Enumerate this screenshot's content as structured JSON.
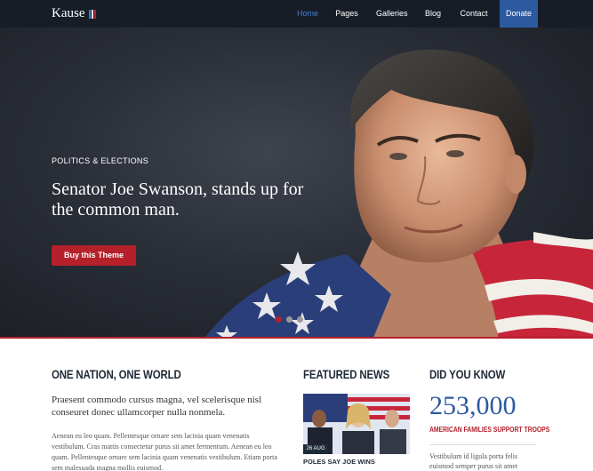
{
  "brand": {
    "name": "Kause",
    "bar_colors": [
      "#3d7fd1",
      "#ffffff",
      "#b5202a"
    ]
  },
  "nav": {
    "items": [
      {
        "label": "Home",
        "active": true
      },
      {
        "label": "Pages",
        "active": false
      },
      {
        "label": "Galleries",
        "active": false
      },
      {
        "label": "Blog",
        "active": false
      },
      {
        "label": "Contact",
        "active": false
      }
    ],
    "donate": "Donate"
  },
  "hero": {
    "kicker": "POLITICS & ELECTIONS",
    "title": "Senator Joe Swanson, stands up for the common man.",
    "button": "Buy this Theme",
    "slides_total": 3,
    "active_slide": 1
  },
  "section_one": {
    "heading": "ONE NATION, ONE WORLD",
    "intro": "Praesent commodo cursus magna, vel scelerisque nisl conseuret donec ullamcorper nulla nonmela.",
    "body": "Aenean eu leo quam. Pellentesque ornare sem lacinia quam venenatis vestibulum. Cras mattis consectetur purus sit amet fermentum. Aenean eu leo quam. Pellentesque ornare sem lacinia quam venenatis vestibulum. Etiam porta sem malesuada magna mollis euismod."
  },
  "featured_news": {
    "heading": "FEATURED NEWS",
    "date": "26 AUG",
    "title": "POLES SAY JOE WINS"
  },
  "did_you_know": {
    "heading": "DID YOU KNOW",
    "number": "253,000",
    "label": "AMERICAN FAMILIES SUPPORT TROOPS",
    "text": "Vestibulum id ligula porta felis euismod semper purus sit amet"
  },
  "colors": {
    "nav_bg": "#171d27",
    "accent_red": "#b5202a",
    "accent_blue": "#2c5aa0"
  }
}
